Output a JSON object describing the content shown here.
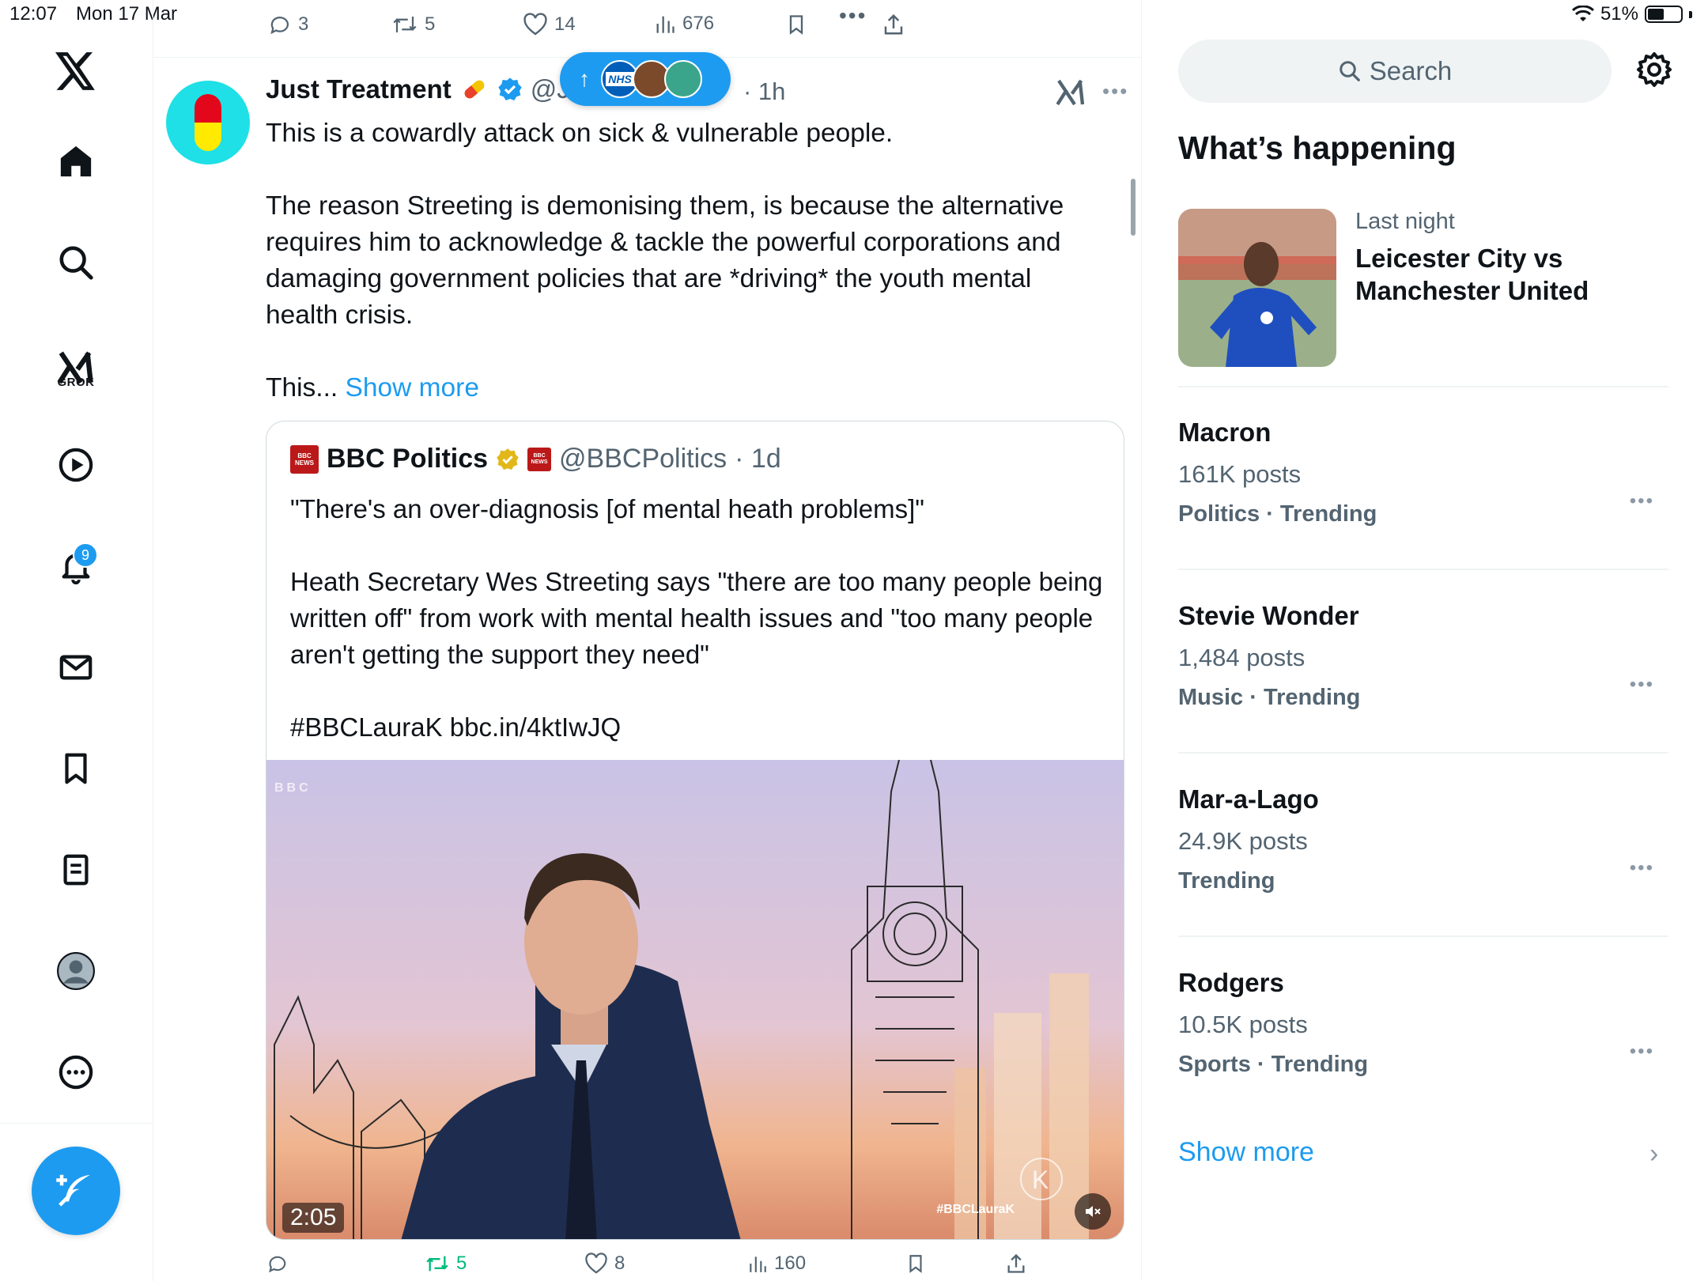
{
  "status_bar": {
    "time": "12:07",
    "date": "Mon 17 Mar",
    "battery": "51%",
    "battery_level": 0.51
  },
  "nav": {
    "grok_label": "GROK",
    "notifications_badge": "9"
  },
  "top_actions": {
    "replies": "3",
    "reposts": "5",
    "likes": "14",
    "views": "676"
  },
  "post": {
    "author": "Just Treatment",
    "handle": "@J",
    "time": "· 1h",
    "text_p1": "This is a cowardly attack on sick & vulnerable people.",
    "text_p2": "The reason Streeting is demonising them, is because the alternative requires him to acknowledge & tackle the powerful corporations and damaging government policies that are *driving* the youth mental health crisis.",
    "text_p3": "This...",
    "show_more": "Show more"
  },
  "quote": {
    "author": "BBC Politics",
    "handle": "@BBCPolitics",
    "time": "· 1d",
    "text_p1": "\"There's an over-diagnosis [of mental heath problems]\"",
    "text_p2": "Heath Secretary Wes Streeting says \"there are too many people being written off\" from work with mental health issues and \"too many people aren't getting the support they need\"",
    "text_p3": "#BBCLauraK bbc.in/4ktIwJQ",
    "video_duration": "2:05",
    "video_tag": "#BBCLauraK"
  },
  "bottom_actions": {
    "reposts": "5",
    "likes": "8",
    "views": "160"
  },
  "sidebar": {
    "search_placeholder": "Search",
    "title": "What’s happening",
    "highlight": {
      "meta": "Last night",
      "title": "Leicester City vs Manchester United"
    },
    "trends": [
      {
        "name": "Macron",
        "posts": "161K posts",
        "category": "Politics · Trending"
      },
      {
        "name": "Stevie Wonder",
        "posts": "1,484 posts",
        "category": "Music · Trending"
      },
      {
        "name": "Mar-a-Lago",
        "posts": "24.9K posts",
        "category": "Trending"
      },
      {
        "name": "Rodgers",
        "posts": "10.5K posts",
        "category": "Sports · Trending"
      }
    ],
    "show_more": "Show more"
  },
  "colors": {
    "accent": "#1d9bf0",
    "text": "#0f1419",
    "secondary": "#536471",
    "repost_active": "#00ba7c"
  }
}
